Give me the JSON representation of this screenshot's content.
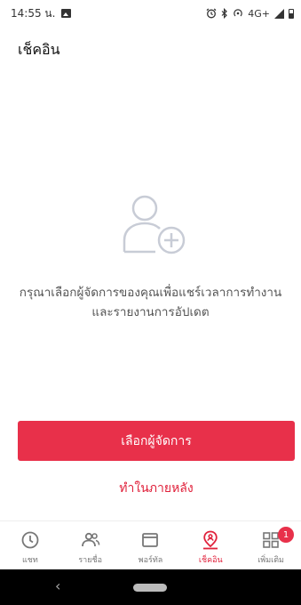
{
  "status_bar": {
    "time": "14:55 น.",
    "network": "4G+"
  },
  "page": {
    "title": "เช็คอิน"
  },
  "empty_state": {
    "icon": "add-person-icon",
    "message": "กรุณาเลือกผู้จัดการของคุณเพื่อแชร์เวลาการทำงานและรายงานการอัปเดต"
  },
  "actions": {
    "primary_label": "เลือกผู้จัดการ",
    "secondary_label": "ทำในภายหลัง"
  },
  "bottom_nav": {
    "items": [
      {
        "label": "แชท",
        "icon": "clock-icon"
      },
      {
        "label": "รายชื่อ",
        "icon": "contacts-icon"
      },
      {
        "label": "พอร์ทัล",
        "icon": "portal-icon"
      },
      {
        "label": "เช็คอิน",
        "icon": "location-person-icon",
        "active": true
      },
      {
        "label": "เพิ่มเติม",
        "icon": "grid-icon",
        "badge": "1"
      }
    ]
  },
  "colors": {
    "accent": "#e8304a",
    "inactive": "#777777"
  }
}
